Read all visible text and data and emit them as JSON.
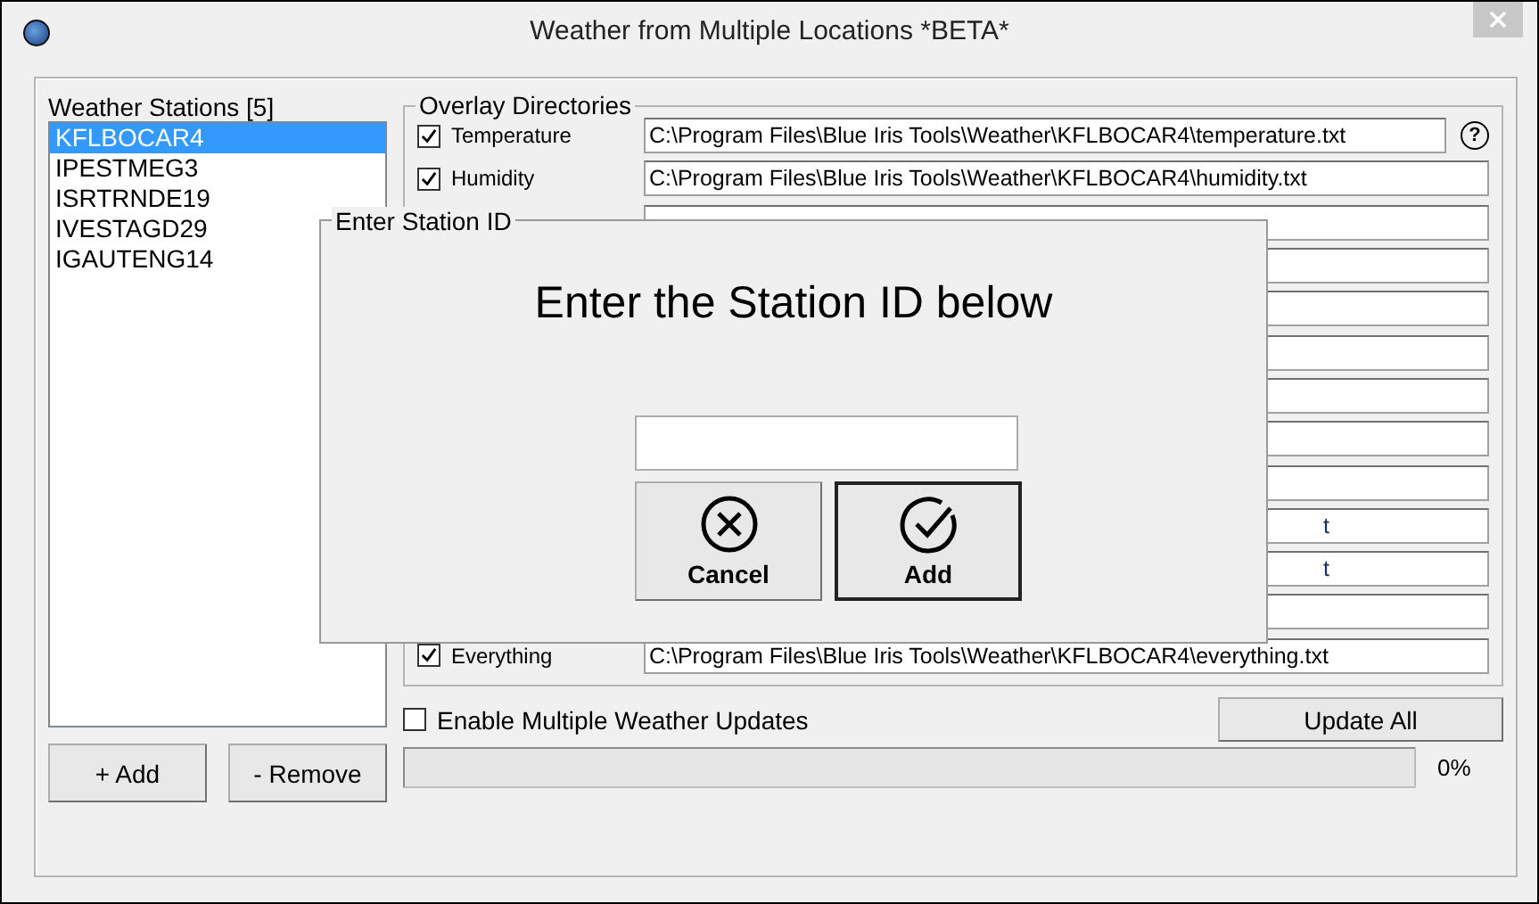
{
  "window": {
    "title": "Weather from Multiple Locations *BETA*"
  },
  "stations": {
    "title": "Weather Stations [5]",
    "items": [
      {
        "label": "KFLBOCAR4",
        "selected": true
      },
      {
        "label": "IPESTMEG3",
        "selected": false
      },
      {
        "label": "ISRTRNDE19",
        "selected": false
      },
      {
        "label": "IVESTAGD29",
        "selected": false
      },
      {
        "label": "IGAUTENG14",
        "selected": false
      }
    ],
    "buttons": [
      "+ Add",
      "- Remove"
    ]
  },
  "overlay": {
    "title": "Overlay Directories",
    "rows": [
      {
        "label": "Temperature",
        "checked": true,
        "path": "C:\\Program Files\\Blue Iris Tools\\Weather\\KFLBOCAR4\\temperature.txt",
        "help": "?"
      },
      {
        "label": "Humidity",
        "checked": true,
        "path": "C:\\Program Files\\Blue Iris Tools\\Weather\\KFLBOCAR4\\humidity.txt"
      },
      {},
      {},
      {},
      {},
      {},
      {},
      {},
      {
        "path": "t"
      },
      {
        "path": "t"
      },
      {},
      {
        "label": "Everything",
        "checked": true,
        "path": "C:\\Program Files\\Blue Iris Tools\\Weather\\KFLBOCAR4\\everything.txt"
      }
    ]
  },
  "multi_updates": {
    "label": "Enable Multiple Weather Updates",
    "checked": false
  },
  "update_all": "Update All",
  "progress": {
    "level": 0,
    "reading": "0%"
  },
  "dialog": {
    "title": "Enter Station ID",
    "heading": "Enter the Station ID below",
    "buttons": [
      {
        "kind": "cancel",
        "label": "Cancel"
      },
      {
        "kind": "add",
        "label": "Add"
      }
    ]
  }
}
